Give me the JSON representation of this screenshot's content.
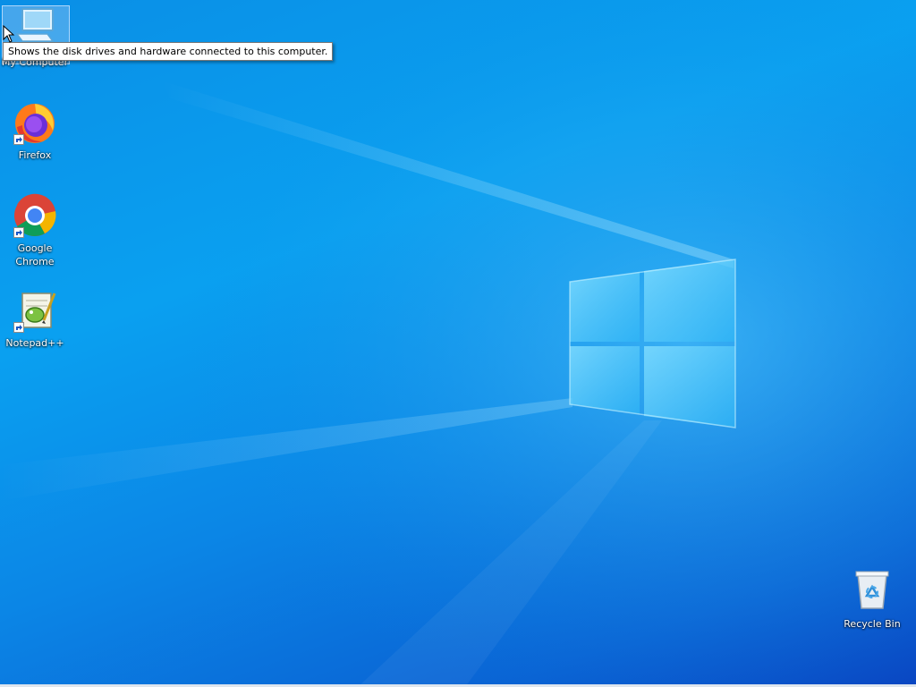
{
  "desktop": {
    "icons": [
      {
        "label": "My Computer",
        "icon": "computer-icon"
      },
      {
        "label": "Firefox",
        "icon": "firefox-icon"
      },
      {
        "label": "Google Chrome",
        "icon": "chrome-icon"
      },
      {
        "label": "Notepad++",
        "icon": "notepadpp-icon"
      },
      {
        "label": "Recycle Bin",
        "icon": "recycle-bin-icon"
      }
    ],
    "tooltip": "Shows the disk drives and hardware connected to this computer."
  },
  "colors": {
    "wallpaper_blue": "#0a8fe6",
    "tooltip_bg": "#ffffff",
    "text": "#ffffff"
  }
}
